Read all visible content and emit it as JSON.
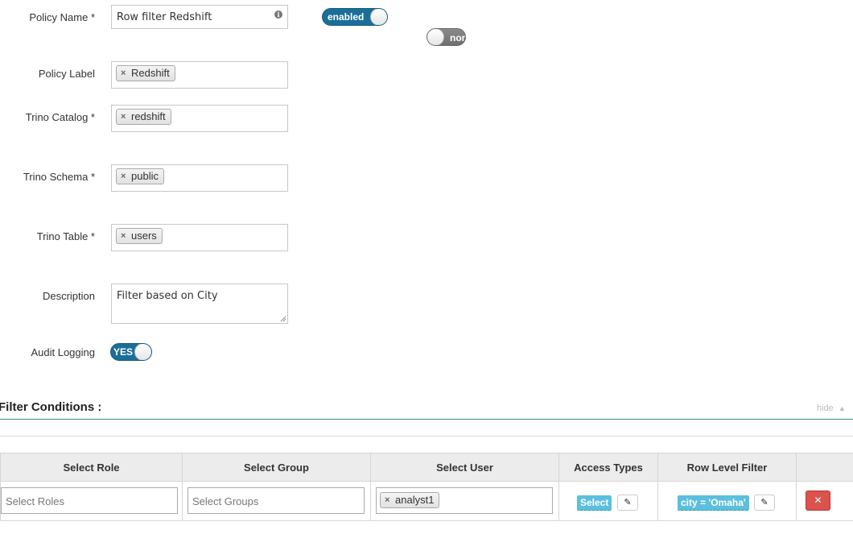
{
  "form": {
    "policy_name": {
      "label": "Policy Name *",
      "value": "Row filter Redshift"
    },
    "enabled_toggle": "enabled",
    "normal_toggle": "nor",
    "policy_label": {
      "label": "Policy Label",
      "tag": "Redshift"
    },
    "trino_catalog": {
      "label": "Trino Catalog *",
      "tag": "redshift"
    },
    "trino_schema": {
      "label": "Trino Schema *",
      "tag": "public"
    },
    "trino_table": {
      "label": "Trino Table *",
      "tag": "users"
    },
    "description": {
      "label": "Description",
      "value": "Filter based on City"
    },
    "audit_logging": {
      "label": "Audit Logging",
      "toggle": "YES"
    }
  },
  "filter_conditions": {
    "title": "Filter Conditions :",
    "hide_label": "hide",
    "columns": [
      "Select Role",
      "Select Group",
      "Select User",
      "Access Types",
      "Row Level Filter",
      ""
    ],
    "row": {
      "roles_placeholder": "Select Roles",
      "groups_placeholder": "Select Groups",
      "user_tag": "analyst1",
      "access_type": "Select",
      "row_filter": "city = 'Omaha'"
    }
  },
  "colors": {
    "toggle_on": "#1a6f9a",
    "accent_line": "#3a8a8c",
    "badge": "#5bc0de",
    "delete": "#d9534f"
  }
}
